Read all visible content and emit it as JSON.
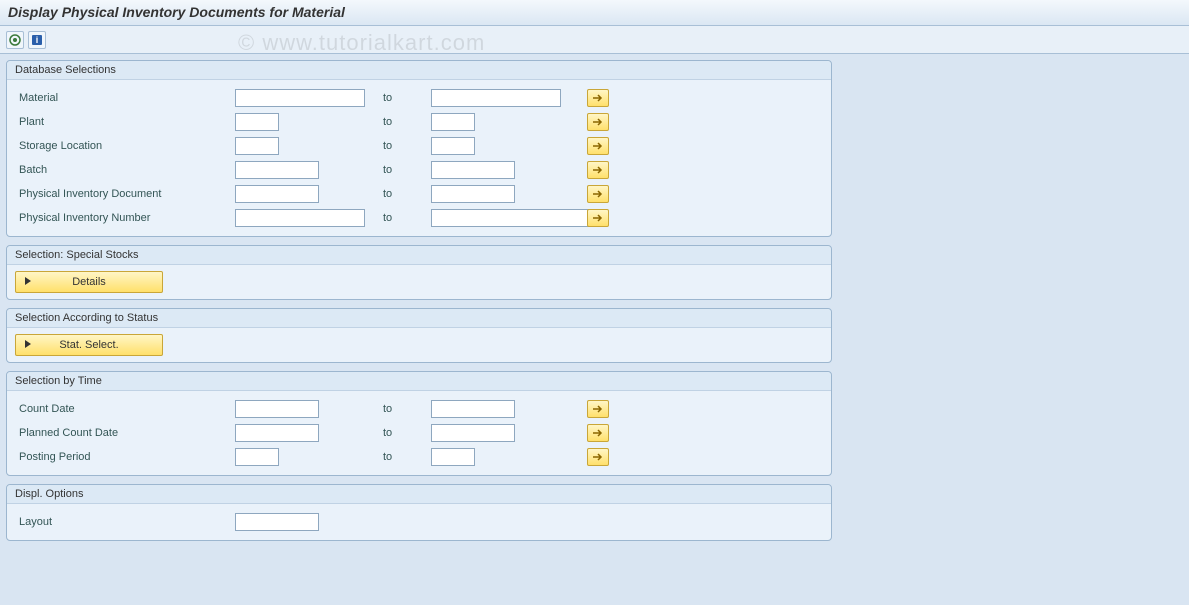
{
  "title": "Display Physical Inventory Documents for Material",
  "watermark": "© www.tutorialkart.com",
  "toolbar": {
    "execute_icon": "execute",
    "info_icon": "info"
  },
  "groups": {
    "database": {
      "title": "Database Selections",
      "rows": [
        {
          "label": "Material",
          "to": "to",
          "size1": "w",
          "size2": "w"
        },
        {
          "label": "Plant",
          "to": "to",
          "size1": "s",
          "size2": "s"
        },
        {
          "label": "Storage Location",
          "to": "to",
          "size1": "s",
          "size2": "s"
        },
        {
          "label": "Batch",
          "to": "to",
          "size1": "m",
          "size2": "m"
        },
        {
          "label": "Physical Inventory Document",
          "to": "to",
          "size1": "m",
          "size2": "m"
        },
        {
          "label": "Physical Inventory Number",
          "to": "to",
          "size1": "w",
          "size2": "xw"
        }
      ]
    },
    "special": {
      "title": "Selection: Special Stocks",
      "button": "Details"
    },
    "status": {
      "title": "Selection According to Status",
      "button": "Stat. Select."
    },
    "time": {
      "title": "Selection by Time",
      "rows": [
        {
          "label": "Count Date",
          "to": "to",
          "size1": "m",
          "size2": "m"
        },
        {
          "label": "Planned Count Date",
          "to": "to",
          "size1": "m",
          "size2": "m"
        },
        {
          "label": "Posting Period",
          "to": "to",
          "size1": "s",
          "size2": "s"
        }
      ]
    },
    "display": {
      "title": "Displ. Options",
      "rows": [
        {
          "label": "Layout",
          "size1": "m"
        }
      ]
    }
  }
}
